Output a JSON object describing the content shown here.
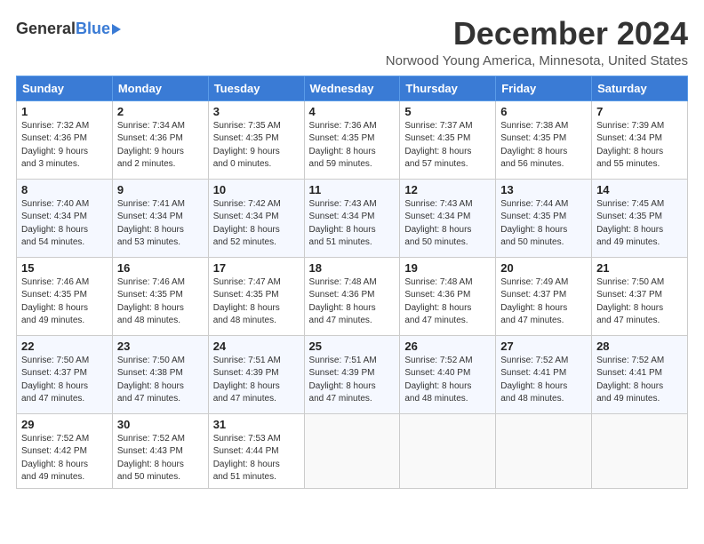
{
  "logo": {
    "general": "General",
    "blue": "Blue"
  },
  "title": {
    "month": "December 2024",
    "location": "Norwood Young America, Minnesota, United States"
  },
  "weekdays": [
    "Sunday",
    "Monday",
    "Tuesday",
    "Wednesday",
    "Thursday",
    "Friday",
    "Saturday"
  ],
  "weeks": [
    [
      {
        "day": "1",
        "sunrise": "7:32 AM",
        "sunset": "4:36 PM",
        "daylight": "9 hours and 3 minutes."
      },
      {
        "day": "2",
        "sunrise": "7:34 AM",
        "sunset": "4:36 PM",
        "daylight": "9 hours and 2 minutes."
      },
      {
        "day": "3",
        "sunrise": "7:35 AM",
        "sunset": "4:35 PM",
        "daylight": "9 hours and 0 minutes."
      },
      {
        "day": "4",
        "sunrise": "7:36 AM",
        "sunset": "4:35 PM",
        "daylight": "8 hours and 59 minutes."
      },
      {
        "day": "5",
        "sunrise": "7:37 AM",
        "sunset": "4:35 PM",
        "daylight": "8 hours and 57 minutes."
      },
      {
        "day": "6",
        "sunrise": "7:38 AM",
        "sunset": "4:35 PM",
        "daylight": "8 hours and 56 minutes."
      },
      {
        "day": "7",
        "sunrise": "7:39 AM",
        "sunset": "4:34 PM",
        "daylight": "8 hours and 55 minutes."
      }
    ],
    [
      {
        "day": "8",
        "sunrise": "7:40 AM",
        "sunset": "4:34 PM",
        "daylight": "8 hours and 54 minutes."
      },
      {
        "day": "9",
        "sunrise": "7:41 AM",
        "sunset": "4:34 PM",
        "daylight": "8 hours and 53 minutes."
      },
      {
        "day": "10",
        "sunrise": "7:42 AM",
        "sunset": "4:34 PM",
        "daylight": "8 hours and 52 minutes."
      },
      {
        "day": "11",
        "sunrise": "7:43 AM",
        "sunset": "4:34 PM",
        "daylight": "8 hours and 51 minutes."
      },
      {
        "day": "12",
        "sunrise": "7:43 AM",
        "sunset": "4:34 PM",
        "daylight": "8 hours and 50 minutes."
      },
      {
        "day": "13",
        "sunrise": "7:44 AM",
        "sunset": "4:35 PM",
        "daylight": "8 hours and 50 minutes."
      },
      {
        "day": "14",
        "sunrise": "7:45 AM",
        "sunset": "4:35 PM",
        "daylight": "8 hours and 49 minutes."
      }
    ],
    [
      {
        "day": "15",
        "sunrise": "7:46 AM",
        "sunset": "4:35 PM",
        "daylight": "8 hours and 49 minutes."
      },
      {
        "day": "16",
        "sunrise": "7:46 AM",
        "sunset": "4:35 PM",
        "daylight": "8 hours and 48 minutes."
      },
      {
        "day": "17",
        "sunrise": "7:47 AM",
        "sunset": "4:35 PM",
        "daylight": "8 hours and 48 minutes."
      },
      {
        "day": "18",
        "sunrise": "7:48 AM",
        "sunset": "4:36 PM",
        "daylight": "8 hours and 47 minutes."
      },
      {
        "day": "19",
        "sunrise": "7:48 AM",
        "sunset": "4:36 PM",
        "daylight": "8 hours and 47 minutes."
      },
      {
        "day": "20",
        "sunrise": "7:49 AM",
        "sunset": "4:37 PM",
        "daylight": "8 hours and 47 minutes."
      },
      {
        "day": "21",
        "sunrise": "7:50 AM",
        "sunset": "4:37 PM",
        "daylight": "8 hours and 47 minutes."
      }
    ],
    [
      {
        "day": "22",
        "sunrise": "7:50 AM",
        "sunset": "4:37 PM",
        "daylight": "8 hours and 47 minutes."
      },
      {
        "day": "23",
        "sunrise": "7:50 AM",
        "sunset": "4:38 PM",
        "daylight": "8 hours and 47 minutes."
      },
      {
        "day": "24",
        "sunrise": "7:51 AM",
        "sunset": "4:39 PM",
        "daylight": "8 hours and 47 minutes."
      },
      {
        "day": "25",
        "sunrise": "7:51 AM",
        "sunset": "4:39 PM",
        "daylight": "8 hours and 47 minutes."
      },
      {
        "day": "26",
        "sunrise": "7:52 AM",
        "sunset": "4:40 PM",
        "daylight": "8 hours and 48 minutes."
      },
      {
        "day": "27",
        "sunrise": "7:52 AM",
        "sunset": "4:41 PM",
        "daylight": "8 hours and 48 minutes."
      },
      {
        "day": "28",
        "sunrise": "7:52 AM",
        "sunset": "4:41 PM",
        "daylight": "8 hours and 49 minutes."
      }
    ],
    [
      {
        "day": "29",
        "sunrise": "7:52 AM",
        "sunset": "4:42 PM",
        "daylight": "8 hours and 49 minutes."
      },
      {
        "day": "30",
        "sunrise": "7:52 AM",
        "sunset": "4:43 PM",
        "daylight": "8 hours and 50 minutes."
      },
      {
        "day": "31",
        "sunrise": "7:53 AM",
        "sunset": "4:44 PM",
        "daylight": "8 hours and 51 minutes."
      },
      null,
      null,
      null,
      null
    ]
  ],
  "labels": {
    "sunrise": "Sunrise:",
    "sunset": "Sunset:",
    "daylight": "Daylight:"
  }
}
